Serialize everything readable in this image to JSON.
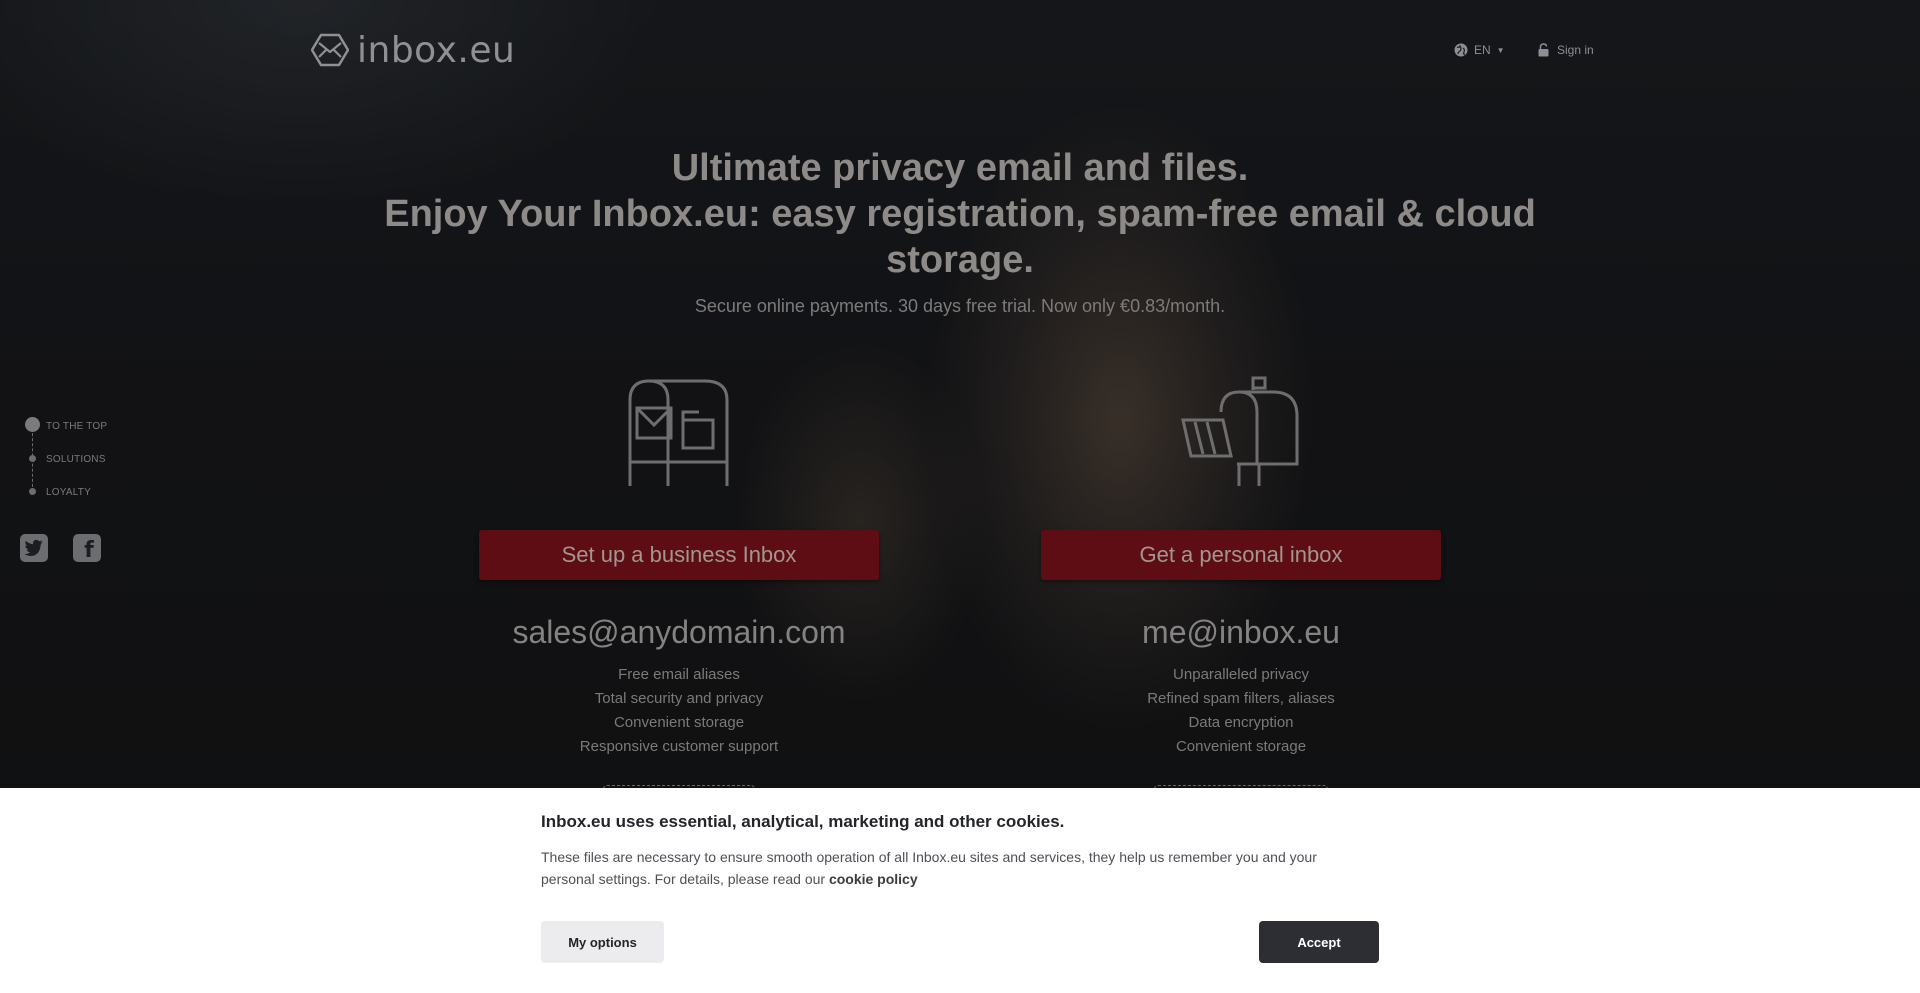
{
  "header": {
    "logo_text": "inbox.eu",
    "language": "EN",
    "signin_label": "Sign in"
  },
  "hero": {
    "headline_line1": "Ultimate privacy email and files.",
    "headline_line2": "Enjoy Your Inbox.eu: easy registration, spam-free email & cloud storage.",
    "subline": "Secure online payments. 30 days free trial. Now only €0.83/month."
  },
  "sidenav": {
    "items": [
      {
        "label": "TO THE TOP"
      },
      {
        "label": "SOLUTIONS"
      },
      {
        "label": "LOYALTY"
      }
    ],
    "social": [
      {
        "icon": "twitter-icon"
      },
      {
        "icon": "facebook-icon"
      }
    ]
  },
  "business": {
    "icon": "mailbox-cabinet-icon",
    "cta_label": "Set up a business Inbox",
    "email": "sales@anydomain.com",
    "features": [
      "Free email aliases",
      "Total security and privacy",
      "Convenient storage",
      "Responsive customer support"
    ]
  },
  "personal": {
    "icon": "mailbox-icon",
    "cta_label": "Get a personal inbox",
    "email": "me@inbox.eu",
    "features": [
      "Unparalleled privacy",
      "Refined spam filters, aliases",
      "Data encryption",
      "Convenient storage"
    ]
  },
  "cookie_banner": {
    "title": "Inbox.eu uses essential, analytical, marketing and other cookies.",
    "text": "These files are necessary to ensure smooth operation of all Inbox.eu sites and services, they help us remember you and your personal settings. For details, please read our",
    "link_label": "cookie policy",
    "options_label": "My options",
    "accept_label": "Accept"
  },
  "colors": {
    "cta_red": "#5d0d13",
    "accept_dark": "#2c2e33",
    "banner_bg": "#ffffff"
  }
}
